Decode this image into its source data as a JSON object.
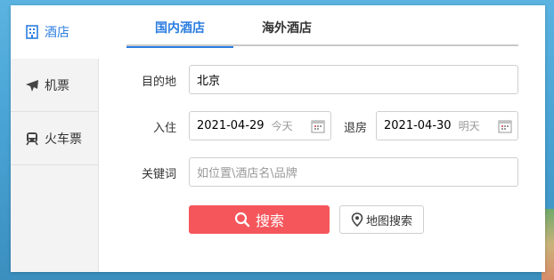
{
  "sidebar": {
    "items": [
      {
        "label": "酒店",
        "icon": "building-icon"
      },
      {
        "label": "机票",
        "icon": "plane-icon"
      },
      {
        "label": "火车票",
        "icon": "train-icon"
      }
    ]
  },
  "tabs": [
    "国内酒店",
    "海外酒店"
  ],
  "form": {
    "destination_label": "目的地",
    "destination_value": "北京",
    "checkin_label": "入住",
    "checkin_date": "2021-04-29",
    "checkin_hint": "今天",
    "checkout_label": "退房",
    "checkout_date": "2021-04-30",
    "checkout_hint": "明天",
    "keyword_label": "关键词",
    "keyword_placeholder": "如位置\\酒店名\\品牌"
  },
  "buttons": {
    "search": "搜索",
    "map_search": "地图搜索"
  },
  "colors": {
    "accent": "#2b7de0",
    "search_button": "#f5565b"
  }
}
